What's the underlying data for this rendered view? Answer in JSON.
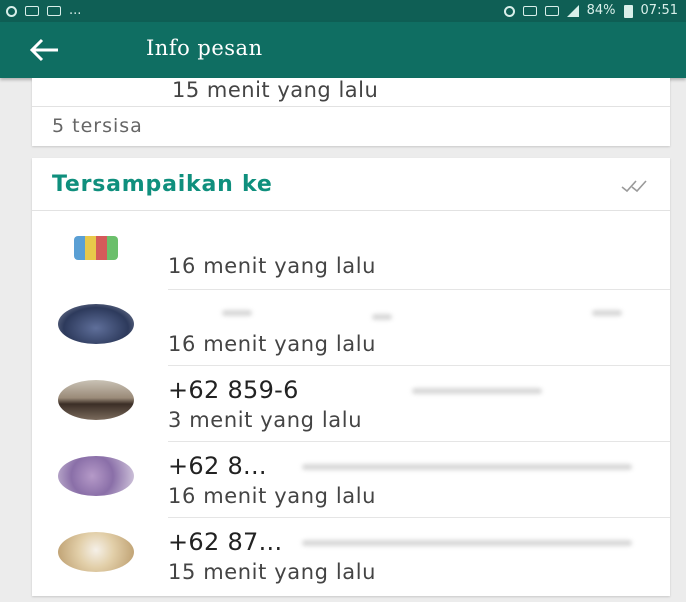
{
  "status_bar": {
    "left_text": "...",
    "battery": "84%",
    "time": "07:51"
  },
  "app_bar": {
    "title": "Info pesan"
  },
  "read_card": {
    "time": "15 menit yang lalu",
    "remaining": "5 tersisa"
  },
  "delivered_card": {
    "header": "Tersampaikan ke",
    "rows": [
      {
        "name": "",
        "time": "16 menit yang lalu"
      },
      {
        "name": "",
        "time": "16 menit yang lalu"
      },
      {
        "name": "+62 859-6",
        "time": "3 menit yang lalu"
      },
      {
        "name": "+62 8...",
        "time": "16 menit yang lalu"
      },
      {
        "name": "+62 87...",
        "time": "15 menit yang lalu"
      }
    ]
  },
  "colors": {
    "app_bar": "#0f6e62",
    "status_bar": "#0f5f55",
    "accent": "#0f8f7d"
  }
}
